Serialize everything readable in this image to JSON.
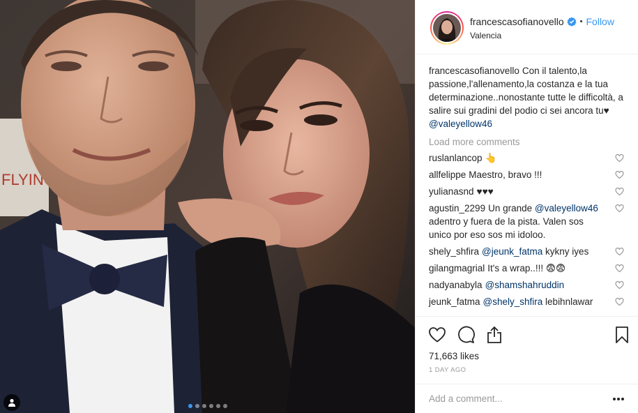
{
  "header": {
    "username": "francescasofianovello",
    "separator": "•",
    "follow_label": "Follow",
    "location": "Valencia"
  },
  "caption": {
    "username": "francescasofianovello",
    "text": "Con il talento,la passione,l'allenamento,la costanza e la tua determinazione..nonostante tutte le difficoltà, a salire sui gradini del podio ci sei ancora tu♥ ",
    "mention": "@valeyellow46"
  },
  "load_more": "Load more comments",
  "comments": [
    {
      "username": "ruslanlancop",
      "text": "👆",
      "mention": "",
      "after": ""
    },
    {
      "username": "allfelippe",
      "text": "Maestro, bravo !!!",
      "mention": "",
      "after": ""
    },
    {
      "username": "yulianasnd",
      "text": "♥♥♥",
      "mention": "",
      "after": ""
    },
    {
      "username": "agustin_2299",
      "text": "Un grande ",
      "mention": "@valeyellow46",
      "after": " adentro y fuera de la pista. Valen sos unico por eso sos mi idoloo."
    },
    {
      "username": "shely_shfira",
      "text": "",
      "mention": "@jeunk_fatma",
      "after": " kykny iyes"
    },
    {
      "username": "gilangmagrial",
      "text": "It's a wrap..!!! 😨😨",
      "mention": "",
      "after": ""
    },
    {
      "username": "nadyanabyla",
      "text": "",
      "mention": "@shamshahruddin",
      "after": ""
    },
    {
      "username": "jeunk_fatma",
      "text": "",
      "mention": "@shely_shfira",
      "after": " lebihnlawar"
    }
  ],
  "likes": "71,663 likes",
  "time_ago": "1 DAY AGO",
  "add_comment_placeholder": "Add a comment...",
  "carousel": {
    "count": 6,
    "active_index": 0
  },
  "colors": {
    "accent": "#3897f0",
    "mention": "#003569",
    "muted": "#999999"
  },
  "icons": [
    "heart-icon",
    "comment-icon",
    "share-icon",
    "bookmark-icon",
    "more-options-icon",
    "verified-badge-icon",
    "user-tag-icon"
  ]
}
